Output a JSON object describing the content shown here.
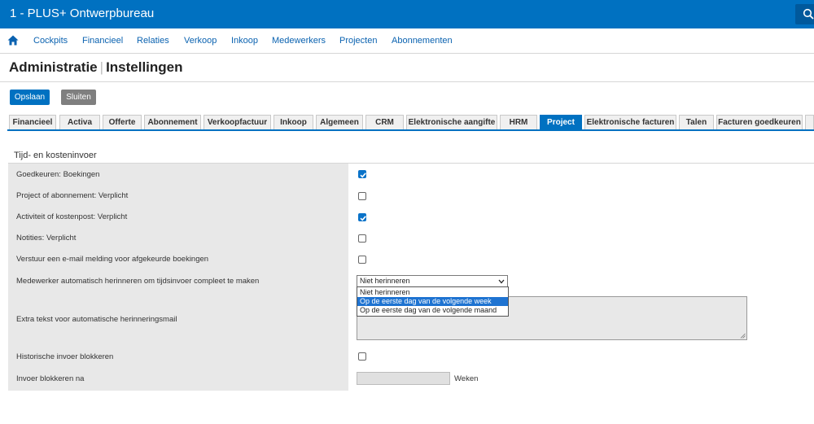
{
  "header": {
    "company": "1 - PLUS+ Ontwerpbureau"
  },
  "nav": {
    "items": [
      "Cockpits",
      "Financieel",
      "Relaties",
      "Verkoop",
      "Inkoop",
      "Medewerkers",
      "Projecten",
      "Abonnementen"
    ]
  },
  "page": {
    "title": "Administratie",
    "subtitle": "Instellingen"
  },
  "buttons": {
    "save": "Opslaan",
    "close": "Sluiten"
  },
  "tabs": {
    "items": [
      "Financieel",
      "Activa",
      "Offerte",
      "Abonnement",
      "Verkoopfactuur",
      "Inkoop",
      "Algemeen",
      "CRM",
      "Elektronische aangifte",
      "HRM",
      "Project",
      "Elektronische facturen",
      "Talen",
      "Facturen goedkeuren"
    ],
    "active": "Project"
  },
  "section": {
    "heading": "Tijd- en kosteninvoer"
  },
  "form": {
    "approve_bookings": {
      "label": "Goedkeuren: Boekingen",
      "checked": true
    },
    "project_required": {
      "label": "Project of abonnement: Verplicht",
      "checked": false
    },
    "activity_required": {
      "label": "Activiteit of kostenpost: Verplicht",
      "checked": true
    },
    "notes_required": {
      "label": "Notities: Verplicht",
      "checked": false
    },
    "email_rejected": {
      "label": "Verstuur een e-mail melding voor afgekeurde boekingen",
      "checked": false
    },
    "auto_reminder": {
      "label": "Medewerker automatisch herinneren om tijdsinvoer compleet te maken",
      "value": "Niet herinneren",
      "options": [
        "Niet herinneren",
        "Op de eerste dag van de volgende week",
        "Op de eerste dag van de volgende maand"
      ],
      "highlighted": "Op de eerste dag van de volgende week"
    },
    "extra_text": {
      "label": "Extra tekst voor automatische herinneringsmail"
    },
    "block_history": {
      "label": "Historische invoer blokkeren",
      "checked": false
    },
    "block_after": {
      "label": "Invoer blokkeren na",
      "unit": "Weken"
    }
  },
  "colors": {
    "brand": "#0071c1",
    "nav_link": "#0a62b0",
    "active_tab": "#0071c1",
    "checkbox": "#0a73c9",
    "label_bg": "#e8e8e8"
  }
}
